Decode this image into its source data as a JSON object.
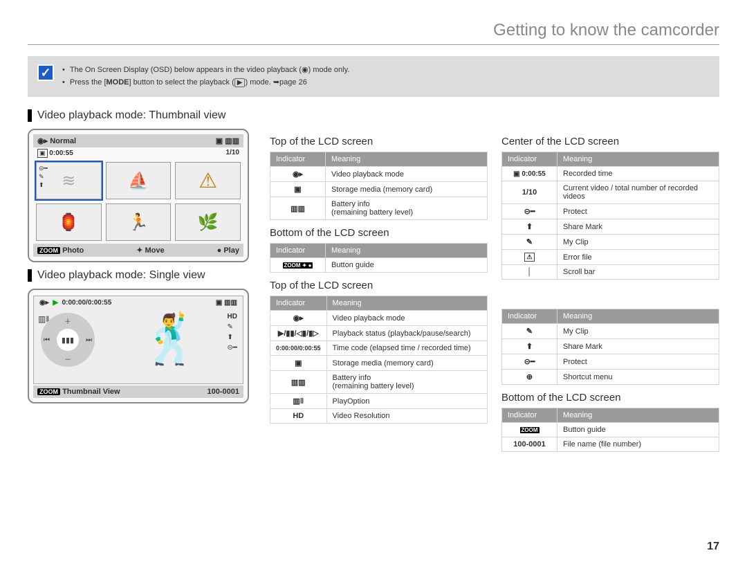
{
  "chapter_title": "Getting to know the camcorder",
  "notes": {
    "line1_a": "The On Screen Display (OSD) below appears in the video playback (",
    "line1_b": ") mode only.",
    "line2_a": "Press the [",
    "line2_mode": "MODE",
    "line2_b": "] button to select the playback (",
    "line2_c": ") mode. ",
    "line2_ref": "➥page 26"
  },
  "section_thumb": "Video playback mode: Thumbnail view",
  "section_single": "Video playback mode: Single view",
  "lcd_thumb": {
    "header_left": "Normal",
    "meta_time": "0:00:55",
    "meta_count": "1/10",
    "footer_zoom": "ZOOM",
    "footer_photo": "Photo",
    "footer_move": "Move",
    "footer_play": "Play"
  },
  "lcd_single": {
    "top_time": "0:00:00/0:00:55",
    "footer_zoom": "ZOOM",
    "footer_label": "Thumbnail View",
    "footer_file": "100-0001",
    "badge_hd": "HD",
    "badge_share": "⬆",
    "badge_key": "⊝━",
    "badge_play": "▶"
  },
  "headings": {
    "top_lcd": "Top of the LCD screen",
    "bottom_lcd": "Bottom of the LCD screen",
    "center_lcd": "Center of the LCD screen"
  },
  "th": {
    "indicator": "Indicator",
    "meaning": "Meaning"
  },
  "table_top1": [
    {
      "icon": "◉▸",
      "meaning": "Video playback mode"
    },
    {
      "icon": "▣",
      "meaning": "Storage media (memory card)"
    },
    {
      "icon": "▥▥",
      "meaning": "Battery info\n(remaining battery level)"
    }
  ],
  "table_bottom1": [
    {
      "icon": "ZOOM ✦ ●",
      "meaning": "Button guide"
    }
  ],
  "table_center": [
    {
      "icon": "▣ 0:00:55",
      "meaning": "Recorded time"
    },
    {
      "icon": "1/10",
      "meaning": "Current video / total number of recorded videos"
    },
    {
      "icon": "⊝━",
      "meaning": "Protect"
    },
    {
      "icon": "⬆",
      "meaning": "Share Mark"
    },
    {
      "icon": "✎",
      "meaning": "My Clip"
    },
    {
      "icon": "⚠",
      "meaning": "Error file"
    },
    {
      "icon": "│",
      "meaning": "Scroll bar"
    }
  ],
  "table_top2_left": [
    {
      "icon": "◉▸",
      "meaning": "Video playback mode"
    },
    {
      "icon": "▶/▮▮/◁▮/▮▷",
      "meaning": "Playback status (playback/pause/search)"
    },
    {
      "icon": "0:00:00/0:00:55",
      "meaning": "Time code (elapsed time / recorded time)"
    },
    {
      "icon": "▣",
      "meaning": "Storage media (memory card)"
    },
    {
      "icon": "▥▥",
      "meaning": "Battery info\n(remaining battery level)"
    },
    {
      "icon": "▥‖",
      "meaning": "PlayOption"
    },
    {
      "icon": "HD",
      "meaning": "Video Resolution"
    }
  ],
  "table_top2_right": [
    {
      "icon": "✎",
      "meaning": "My Clip"
    },
    {
      "icon": "⬆",
      "meaning": "Share Mark"
    },
    {
      "icon": "⊝━",
      "meaning": "Protect"
    },
    {
      "icon": "⊕",
      "meaning": "Shortcut menu"
    }
  ],
  "table_bottom2": [
    {
      "icon": "ZOOM",
      "meaning": "Button guide"
    },
    {
      "icon": "100-0001",
      "meaning": "File name (file number)"
    }
  ],
  "page_number": "17"
}
